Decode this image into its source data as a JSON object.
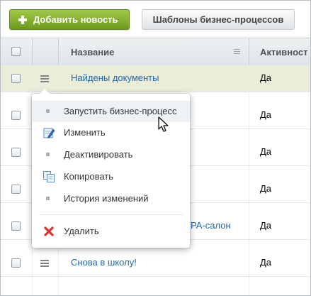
{
  "toolbar": {
    "add_label": "Добавить новость",
    "templates_label": "Шаблоны бизнес-процессов"
  },
  "table": {
    "columns": {
      "name": "Название",
      "active": "Активност"
    },
    "rows": [
      {
        "name": "Найдены документы",
        "active": "Да",
        "selected": true
      },
      {
        "name": "",
        "active": "Да"
      },
      {
        "name": "",
        "active": "Да"
      },
      {
        "name": "",
        "active": "Да"
      },
      {
        "name": "РА-салон",
        "active": "Да"
      },
      {
        "name": "Снова в школу!",
        "active": "Да"
      }
    ]
  },
  "context_menu": {
    "items": [
      {
        "label": "Запустить бизнес-процесс",
        "icon": "bullet-icon"
      },
      {
        "label": "Изменить",
        "icon": "edit-icon"
      },
      {
        "label": "Деактивировать",
        "icon": "bullet-icon"
      },
      {
        "label": "Копировать",
        "icon": "copy-icon"
      },
      {
        "label": "История изменений",
        "icon": "bullet-icon"
      },
      {
        "label": "Удалить",
        "icon": "delete-icon"
      }
    ]
  },
  "colors": {
    "add_button": "#7aa82a",
    "link": "#2067b0",
    "selected_row": "#e9edd9",
    "delete_icon": "#d9352b"
  }
}
